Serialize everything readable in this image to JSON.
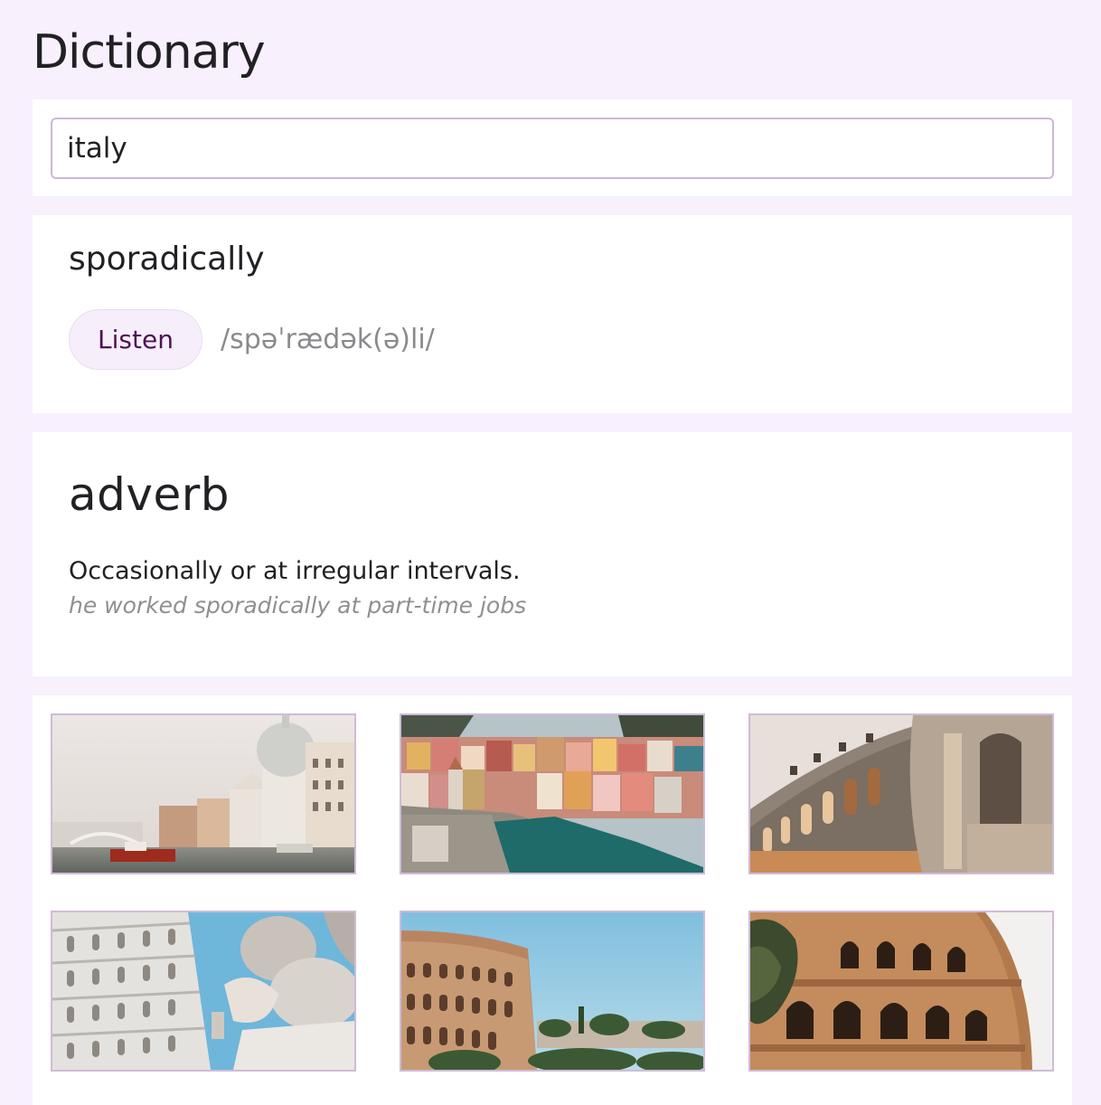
{
  "header": {
    "title": "Dictionary"
  },
  "search": {
    "value": "italy"
  },
  "word": {
    "keyword": "sporadically",
    "listen_label": "Listen",
    "phonetic": "/spəˈrædək(ə)li/"
  },
  "meaning": {
    "part_of_speech": "adverb",
    "definition": "Occasionally or at irregular intervals.",
    "example": "he worked sporadically at part-time jobs"
  },
  "images": [
    {
      "icon": "venice-grand-canal-photo"
    },
    {
      "icon": "cinque-terre-vernazza-photo"
    },
    {
      "icon": "pula-arena-arches-photo"
    },
    {
      "icon": "leaning-tower-pisa-statue-photo"
    },
    {
      "icon": "colosseum-sky-photo"
    },
    {
      "icon": "colosseum-closeup-photo"
    }
  ],
  "colors": {
    "page_background": "#f8f0fd",
    "card_background": "#ffffff",
    "accent_text": "#4d1454",
    "listen_background": "#f7eefc",
    "input_border": "#cbb8d8",
    "muted_text": "#8a8a8e"
  }
}
